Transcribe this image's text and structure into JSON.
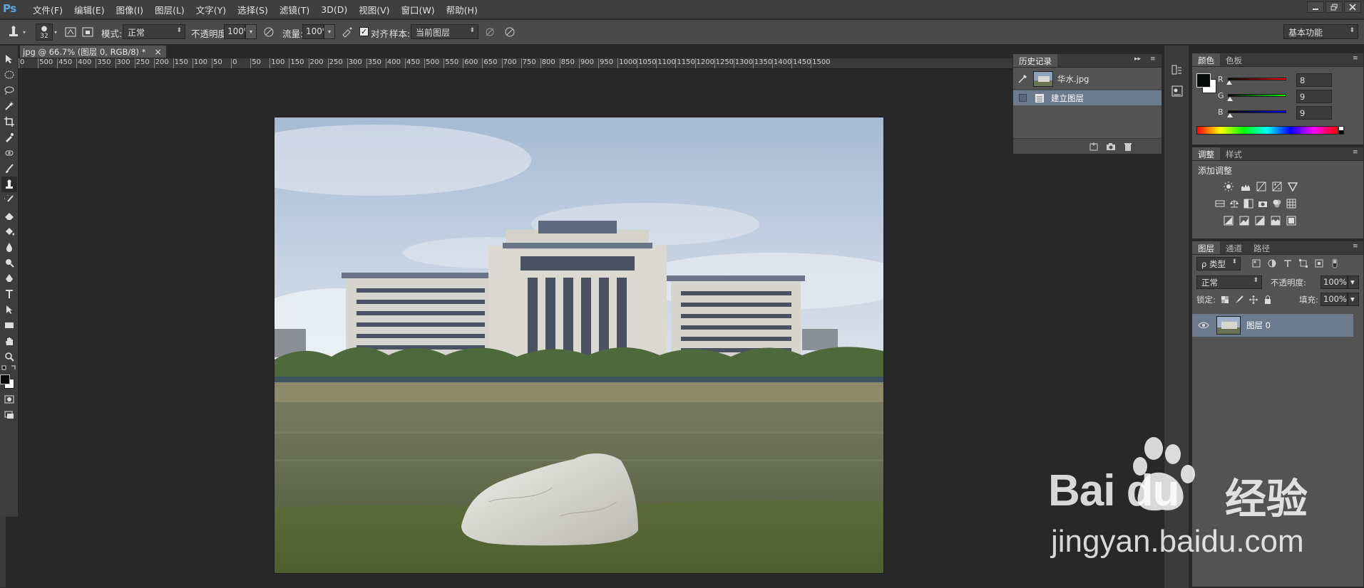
{
  "app": {
    "logo": "Ps",
    "menus": [
      "文件(F)",
      "编辑(E)",
      "图像(I)",
      "图层(L)",
      "文字(Y)",
      "选择(S)",
      "滤镜(T)",
      "3D(D)",
      "视图(V)",
      "窗口(W)",
      "帮助(H)"
    ]
  },
  "options": {
    "brush_size": "32",
    "mode_label": "模式:",
    "mode_value": "正常",
    "opacity_label": "不透明度:",
    "opacity_value": "100%",
    "flow_label": "流量:",
    "flow_value": "100%",
    "align_label": "对齐",
    "align_checked": "✓",
    "sample_label": "样本:",
    "sample_value": "当前图层",
    "workspace": "基本功能"
  },
  "document": {
    "tab_title": "jpg @ 66.7% (图层 0, RGB/8) *",
    "close_glyph": "×",
    "ruler_labels": [
      "0",
      "500",
      "450",
      "400",
      "350",
      "300",
      "250",
      "200",
      "150",
      "100",
      "50",
      "0",
      "50",
      "100",
      "150",
      "200",
      "250",
      "300",
      "350",
      "400",
      "450",
      "500",
      "550",
      "600",
      "650",
      "700",
      "750",
      "800",
      "850",
      "900",
      "950",
      "1000",
      "1050",
      "1100",
      "1150",
      "1200",
      "1250",
      "1300",
      "1350",
      "1400",
      "1450",
      "1500"
    ]
  },
  "history": {
    "tab": "历史记录",
    "snapshot_name": "华水.jpg",
    "steps": [
      "建立图层"
    ]
  },
  "color_panel": {
    "tabs": [
      "颜色",
      "色板"
    ],
    "r_label": "R",
    "r_value": "8",
    "g_label": "G",
    "g_value": "9",
    "b_label": "B",
    "b_value": "9",
    "r_level": 0.03,
    "g_level": 0.035,
    "b_level": 0.035
  },
  "adjust_panel": {
    "tabs": [
      "调整",
      "样式"
    ],
    "title": "添加调整"
  },
  "layers_panel": {
    "tabs": [
      "图层",
      "通道",
      "路径"
    ],
    "filter_value": "ρ 类型",
    "blend_mode": "正常",
    "opacity_label": "不透明度:",
    "opacity_value": "100%",
    "lock_label": "锁定:",
    "fill_label": "填充:",
    "fill_value": "100%",
    "layers": [
      {
        "name": "图层 0"
      }
    ]
  },
  "watermark": {
    "brand": "Bai  du",
    "suffix": "经验",
    "url": "jingyan.baidu.com"
  },
  "colors": {
    "accent_blue": "#5aa6e6",
    "panel_bg": "#535353",
    "layer_selected": "#6c7a8e"
  }
}
